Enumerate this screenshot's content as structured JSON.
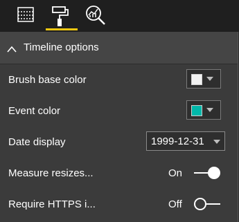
{
  "tabs": [
    {
      "icon": "fields-icon",
      "active": false
    },
    {
      "icon": "format-paintroller-icon",
      "active": true
    },
    {
      "icon": "analytics-icon",
      "active": false
    }
  ],
  "accent_color": "#f2c811",
  "section": {
    "title": "Timeline options",
    "expanded": true
  },
  "rows": {
    "brush": {
      "label": "Brush base color",
      "color": "#f2f2f2"
    },
    "event": {
      "label": "Event color",
      "color": "#01b8aa"
    },
    "date": {
      "label": "Date display",
      "value": "1999-12-31"
    },
    "measure": {
      "label": "Measure resizes...",
      "state": "On"
    },
    "https": {
      "label": "Require HTTPS i...",
      "state": "Off"
    }
  }
}
